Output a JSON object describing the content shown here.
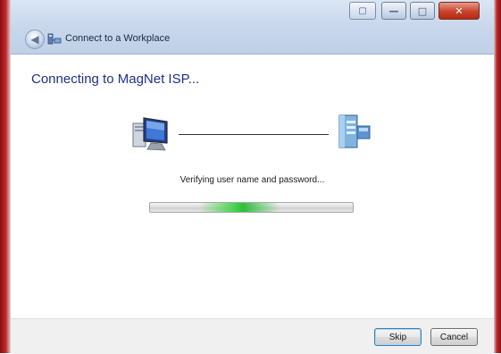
{
  "window": {
    "title": "Connect to a Workplace",
    "accent_close": "#c8432b",
    "frame_color": "#c0272b"
  },
  "icons": {
    "back": "back-arrow-icon",
    "app": "network-connection-icon",
    "computer": "computer-icon",
    "server": "server-icon"
  },
  "main": {
    "heading": "Connecting to MagNet ISP...",
    "status": "Verifying user name and password..."
  },
  "progress": {
    "mode": "indeterminate",
    "color": "#45d34a"
  },
  "footer": {
    "skip_label": "Skip",
    "cancel_label": "Cancel"
  }
}
